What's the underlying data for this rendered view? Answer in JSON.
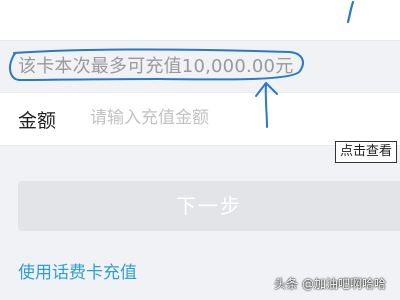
{
  "limit": {
    "text": "该卡本次最多可充值10,000.00元"
  },
  "amount": {
    "label": "金额",
    "placeholder": "请输入充值金额",
    "value": ""
  },
  "tooltip": {
    "text": "点击查看"
  },
  "next_button": {
    "label": "下一步"
  },
  "card_link": {
    "label": "使用话费卡充值"
  },
  "watermark": {
    "text": "头条 @加油吧啊哈哈"
  },
  "colors": {
    "link": "#2f9ed6",
    "annotation": "#2b78c4",
    "button_disabled": "#e3e4e8",
    "page_bg": "#f1f2f6"
  }
}
